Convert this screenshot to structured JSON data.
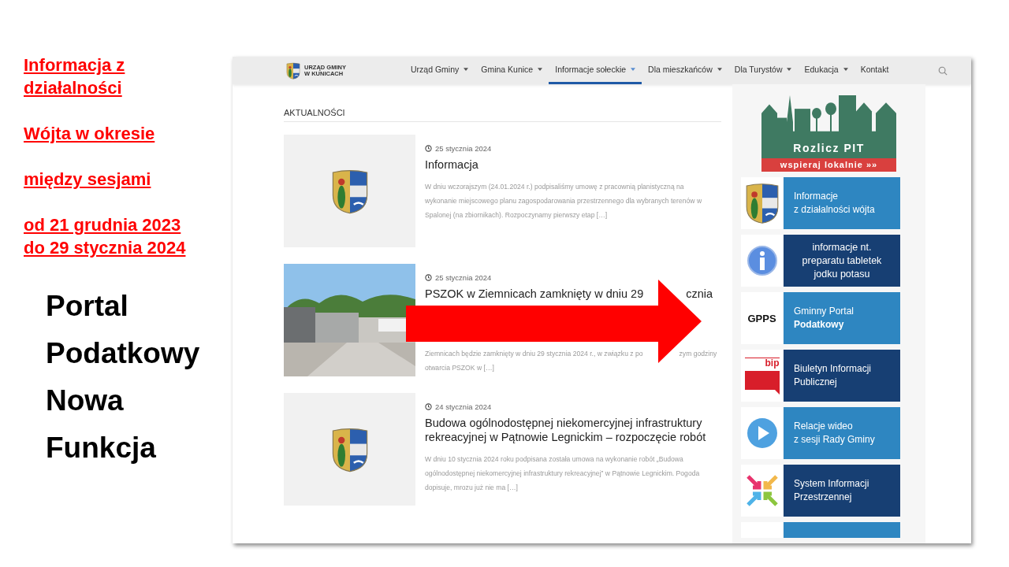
{
  "slide": {
    "red_paragraphs": [
      "Informacja z\ndziałalności",
      "Wójta w okresie",
      "między sesjami",
      "od 21 grudnia 2023\ndo 29 stycznia 2024"
    ],
    "black_lines": [
      "Portal",
      "Podatkowy",
      "Nowa",
      "Funkcja"
    ]
  },
  "website": {
    "logo": {
      "line_1": "URZĄD GMINY",
      "line_2": "W KUNICACH"
    },
    "nav": [
      {
        "label": "Urząd Gminy",
        "selected": false,
        "dropdown": true
      },
      {
        "label": "Gmina Kunice",
        "selected": false,
        "dropdown": true
      },
      {
        "label": "Informacje sołeckie",
        "selected": true,
        "dropdown": true
      },
      {
        "label": "Dla mieszkańców",
        "selected": false,
        "dropdown": true
      },
      {
        "label": "Dla Turystów",
        "selected": false,
        "dropdown": true
      },
      {
        "label": "Edukacja",
        "selected": false,
        "dropdown": true
      },
      {
        "label": "Kontakt",
        "selected": false,
        "dropdown": false
      }
    ],
    "section_title": "AKTUALNOŚCI",
    "articles": [
      {
        "kind": "crest",
        "date": "25 stycznia 2024",
        "title_parts": [
          "Informacja"
        ],
        "excerpt_lines": [
          [
            "W dniu wczorajszym (24.01.2024 r.) podpisaliśmy umowę z pracownią planistyczną na"
          ],
          [
            "wykonanie miejscowego planu zagospodarowania przestrzennego dla wybranych terenów w"
          ],
          [
            "Spalonej (na zbiornikach). Rozpoczynamy pierwszy etap […]"
          ]
        ]
      },
      {
        "kind": "picture",
        "date": "25 stycznia 2024",
        "title_parts": [
          "PSZOK w Ziemnicach zamknięty w dniu 29",
          "cznia"
        ],
        "excerpt_lines": [
          [
            "Ziemnicach będzie zamknięty w dniu 29 stycznia 2024 r., w związku z po",
            "zym godziny"
          ],
          [
            "otwarcia PSZOK w […]"
          ]
        ]
      },
      {
        "kind": "crest",
        "date": "24 stycznia 2024",
        "title_parts": [
          "Budowa ogólnodostępnej niekomercyjnej infrastruktury rekreacyjnej w Pątnowie Legnickim – rozpoczęcie robót"
        ],
        "excerpt_lines": [
          [
            "W dniu 10 stycznia 2024 roku podpisana została umowa na wykonanie robót „Budowa"
          ],
          [
            "ogólnodostępnej niekomercyjnej infrastruktury rekreacyjnej” w Pątnowie Legnickim. Pogoda"
          ],
          [
            "dopisuje, mrozu już nie ma […]"
          ]
        ]
      }
    ],
    "banner": {
      "title": "Rozlicz PIT",
      "subtitle": "wspieraj lokalnie »»"
    },
    "tiles": [
      {
        "kind": "crest",
        "text": "Informacje\nz działalności wójta",
        "color": "#2e86c1",
        "centered": false
      },
      {
        "kind": "info",
        "text": "informacje nt.\npreparatu tabletek\njodku potasu",
        "color": "#173f73",
        "centered": true
      },
      {
        "kind": "gpps",
        "icon_text": "GPPS",
        "text": "Gminny Portal\n**Podatkowy**",
        "color": "#2e86c1",
        "centered": false
      },
      {
        "kind": "bip",
        "icon_text": "bip",
        "text": "Biuletyn Informacji\nPublicznej",
        "color": "#173f73",
        "centered": false
      },
      {
        "kind": "play",
        "text": "Relacje wideo\nz sesji Rady Gminy",
        "color": "#2e86c1",
        "centered": false
      },
      {
        "kind": "arrows",
        "text": "System Informacji\nPrzestrzennej",
        "color": "#173f73",
        "centered": false
      }
    ]
  }
}
